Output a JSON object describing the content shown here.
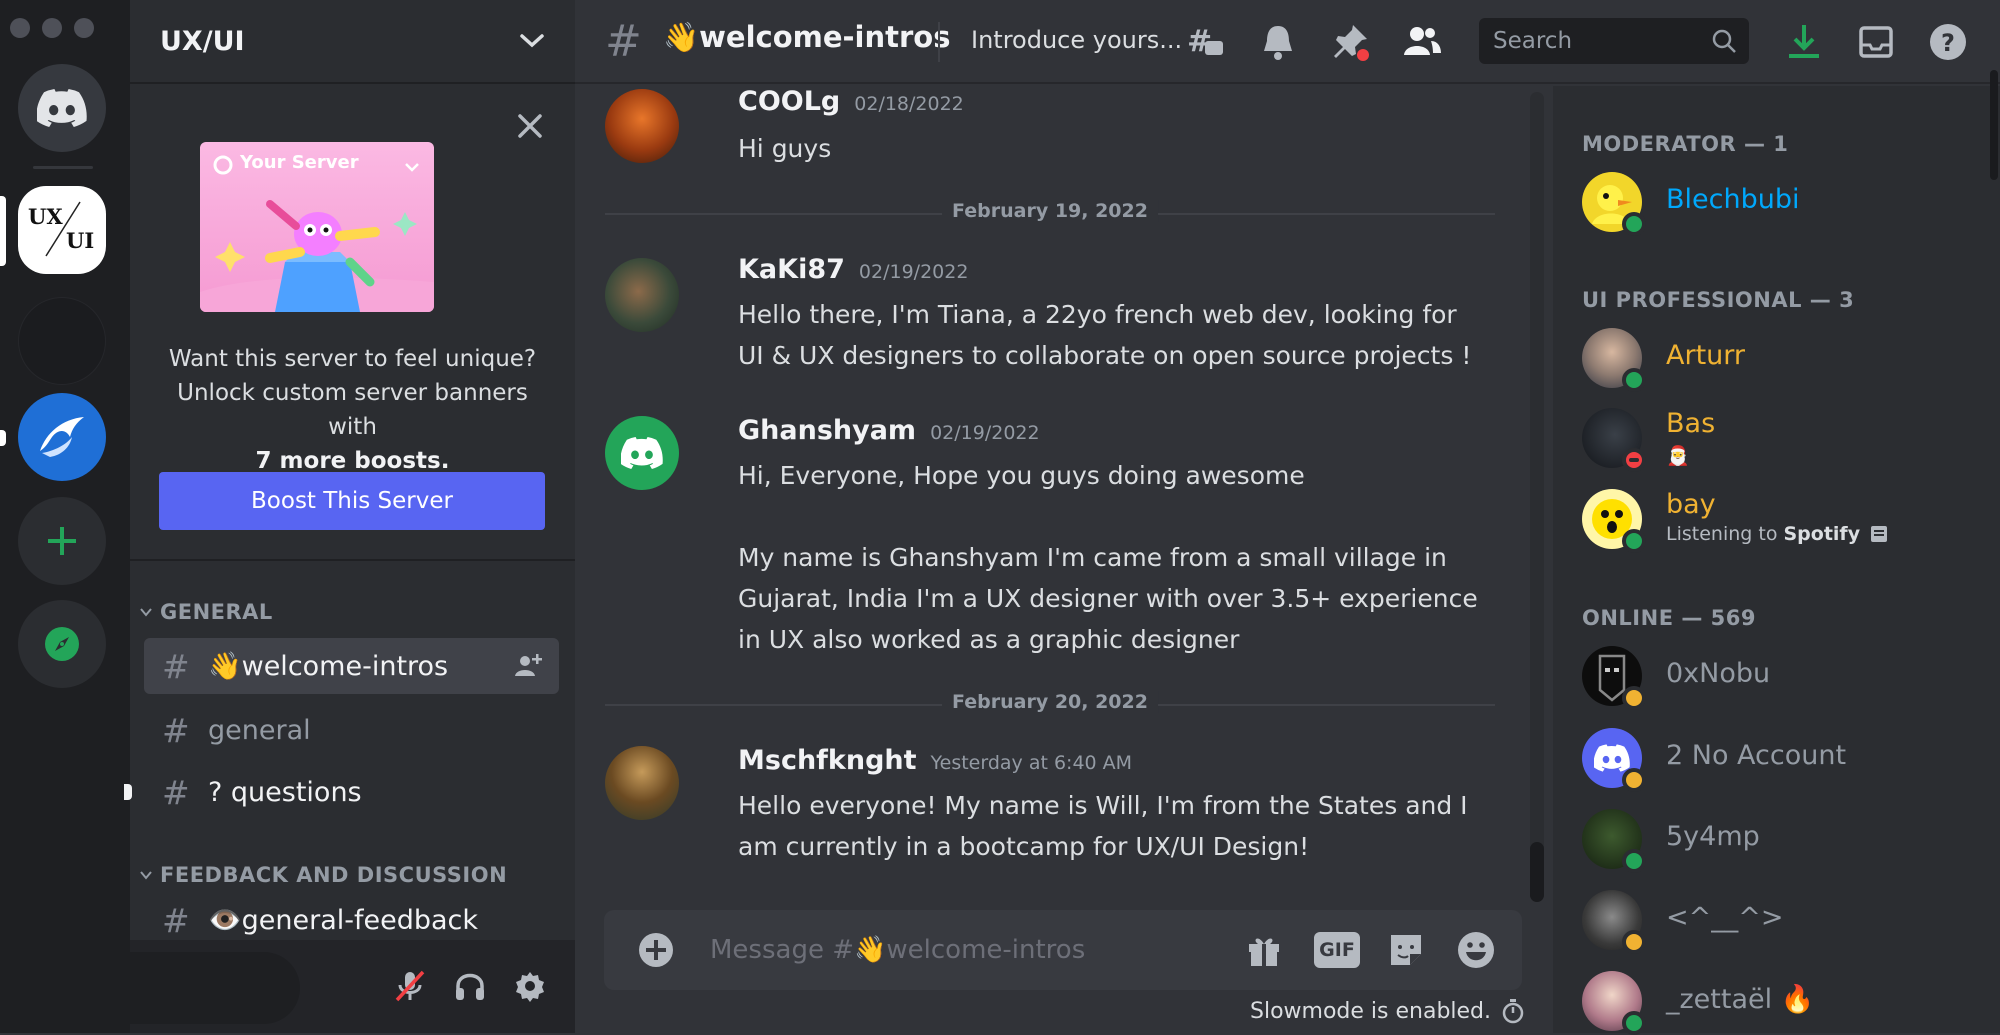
{
  "server": {
    "name": "UX/UI",
    "rail_logo_top": "UX",
    "rail_logo_bottom": "UI"
  },
  "boost": {
    "banner_title": "Your Server",
    "text_line1": "Want this server to feel unique?",
    "text_line2": "Unlock custom server banners with",
    "text_bold": "7 more boosts.",
    "button": "Boost This Server"
  },
  "categories": [
    {
      "name": "GENERAL"
    },
    {
      "name": "FEEDBACK AND DISCUSSION"
    }
  ],
  "channels": [
    {
      "name": "👋welcome-intros",
      "state": "active"
    },
    {
      "name": "general",
      "state": "normal"
    },
    {
      "name": "? questions",
      "state": "unread"
    },
    {
      "name": "👁️general-feedback",
      "state": "unread"
    }
  ],
  "header": {
    "channel": "👋welcome-intros",
    "topic": "Introduce yours...",
    "search_placeholder": "Search"
  },
  "messages": [
    {
      "author": "COOLg",
      "timestamp": "02/18/2022",
      "lines": [
        "Hi guys"
      ]
    },
    {
      "author": "KaKi87",
      "timestamp": "02/19/2022",
      "lines": [
        "Hello there, I'm Tiana, a 22yo french web dev, looking for",
        "UI & UX designers to collaborate on open source projects !"
      ]
    },
    {
      "author": "Ghanshyam",
      "timestamp": "02/19/2022",
      "lines": [
        "Hi, Everyone, Hope you guys doing awesome",
        "",
        "My name is Ghanshyam I'm came from a small village in",
        "Gujarat, India I'm a UX designer with over 3.5+ experience",
        "in UX also worked as a graphic designer"
      ]
    },
    {
      "author": "Mschfknght",
      "timestamp": "Yesterday at 6:40 AM",
      "lines": [
        "Hello everyone! My name is Will, I'm from the States and I",
        "am currently in a bootcamp for UX/UI Design!"
      ]
    }
  ],
  "dividers": [
    "February 19, 2022",
    "February 20, 2022"
  ],
  "composer": {
    "placeholder": "Message #👋welcome-intros",
    "gif": "GIF"
  },
  "slowmode": "Slowmode is enabled.",
  "member_groups": [
    {
      "label": "MODERATOR — 1"
    },
    {
      "label": "UI PROFESSIONAL — 3"
    },
    {
      "label": "ONLINE — 569"
    }
  ],
  "members": [
    {
      "name": "Blechbubi",
      "color": "#00a8fc",
      "status": "online"
    },
    {
      "name": "Arturr",
      "color": "#f0b232",
      "status": "online"
    },
    {
      "name": "Bas",
      "color": "#f0b232",
      "status": "dnd",
      "sub": "🎅"
    },
    {
      "name": "bay",
      "color": "#f0b232",
      "status": "online",
      "sub_prefix": "Listening to",
      "sub_bold": "Spotify"
    },
    {
      "name": "0xNobu",
      "color": "#949ba4",
      "status": "idle"
    },
    {
      "name": "2 No Account",
      "color": "#949ba4",
      "status": "idle"
    },
    {
      "name": "5y4mp",
      "color": "#949ba4",
      "status": "online"
    },
    {
      "name": "<^__^>",
      "color": "#949ba4",
      "status": "idle"
    },
    {
      "name": "_zettaël 🔥",
      "color": "#949ba4",
      "status": "online"
    }
  ],
  "colors": {
    "accent": "#5865f2",
    "online": "#23a559",
    "idle": "#f0b232",
    "dnd": "#f23f43",
    "unread_badge": "#f23f43"
  }
}
